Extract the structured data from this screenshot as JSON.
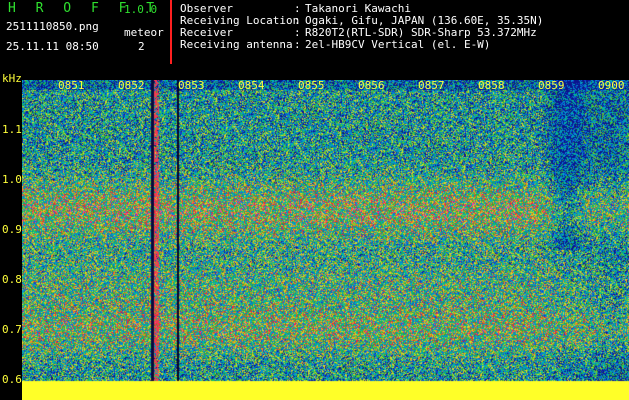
{
  "header": {
    "app_title": "H R O F F T",
    "app_version": "1.0.0",
    "filename": "2511110850.png",
    "mode_label": "meteor",
    "datetime": "25.11.11 08:50",
    "count": "2"
  },
  "info": [
    {
      "label": "Observer",
      "value": "Takanori Kawachi"
    },
    {
      "label": "Receiving Location",
      "value": "Ogaki, Gifu, JAPAN (136.60E, 35.35N)"
    },
    {
      "label": "Receiver",
      "value": "R820T2(RTL-SDR) SDR-Sharp 53.372MHz"
    },
    {
      "label": "Receiving antenna",
      "value": "2el-HB9CV Vertical (el. E-W)"
    }
  ],
  "spectrogram": {
    "y_unit": "kHz",
    "y_ticks": [
      "1.1",
      "1.0",
      "0.9",
      "0.8",
      "0.7",
      "0.6"
    ],
    "time_labels": [
      "0851",
      "0852",
      "0853",
      "0854",
      "0855",
      "0856",
      "0857",
      "0858",
      "0859",
      "0900"
    ],
    "colors": {
      "background": "#000000",
      "text": "#ffff3a",
      "separator": "#ff2020",
      "accent_green": "#2fe02f"
    }
  }
}
